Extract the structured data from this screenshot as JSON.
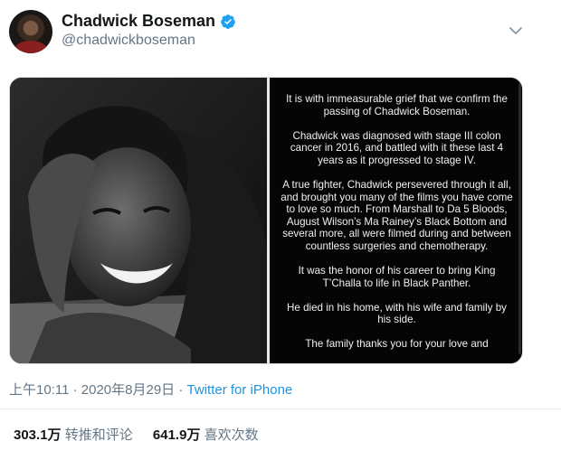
{
  "author": {
    "display_name": "Chadwick Boseman",
    "handle": "@chadwickboseman",
    "verified_color": "#1da1f2"
  },
  "statement": {
    "paragraphs": [
      "It is with immeasurable grief that we confirm the passing of Chadwick Boseman.",
      "Chadwick was diagnosed with stage III colon cancer in 2016, and battled with it these last 4 years as it progressed to stage IV.",
      "A true fighter, Chadwick persevered through it all, and brought you many of the films you have come to love so much. From Marshall to Da 5 Bloods, August Wilson’s Ma Rainey’s Black Bottom and several more, all were filmed during and between countless surgeries and chemotherapy.",
      "It was the honor of his career to bring King T’Challa to life in Black Panther.",
      "He died in his home, with his wife and family by his side.",
      "The family thanks you for your love and"
    ]
  },
  "meta": {
    "time": "上午10:11",
    "dot1": " · ",
    "date": "2020年8月29日",
    "dot2": " · ",
    "source": "Twitter for iPhone",
    "source_color": "#1b95e0"
  },
  "stats": {
    "retweets_value": "303.1万",
    "retweets_label": "转推和评论",
    "likes_value": "641.9万",
    "likes_label": "喜欢次数"
  }
}
